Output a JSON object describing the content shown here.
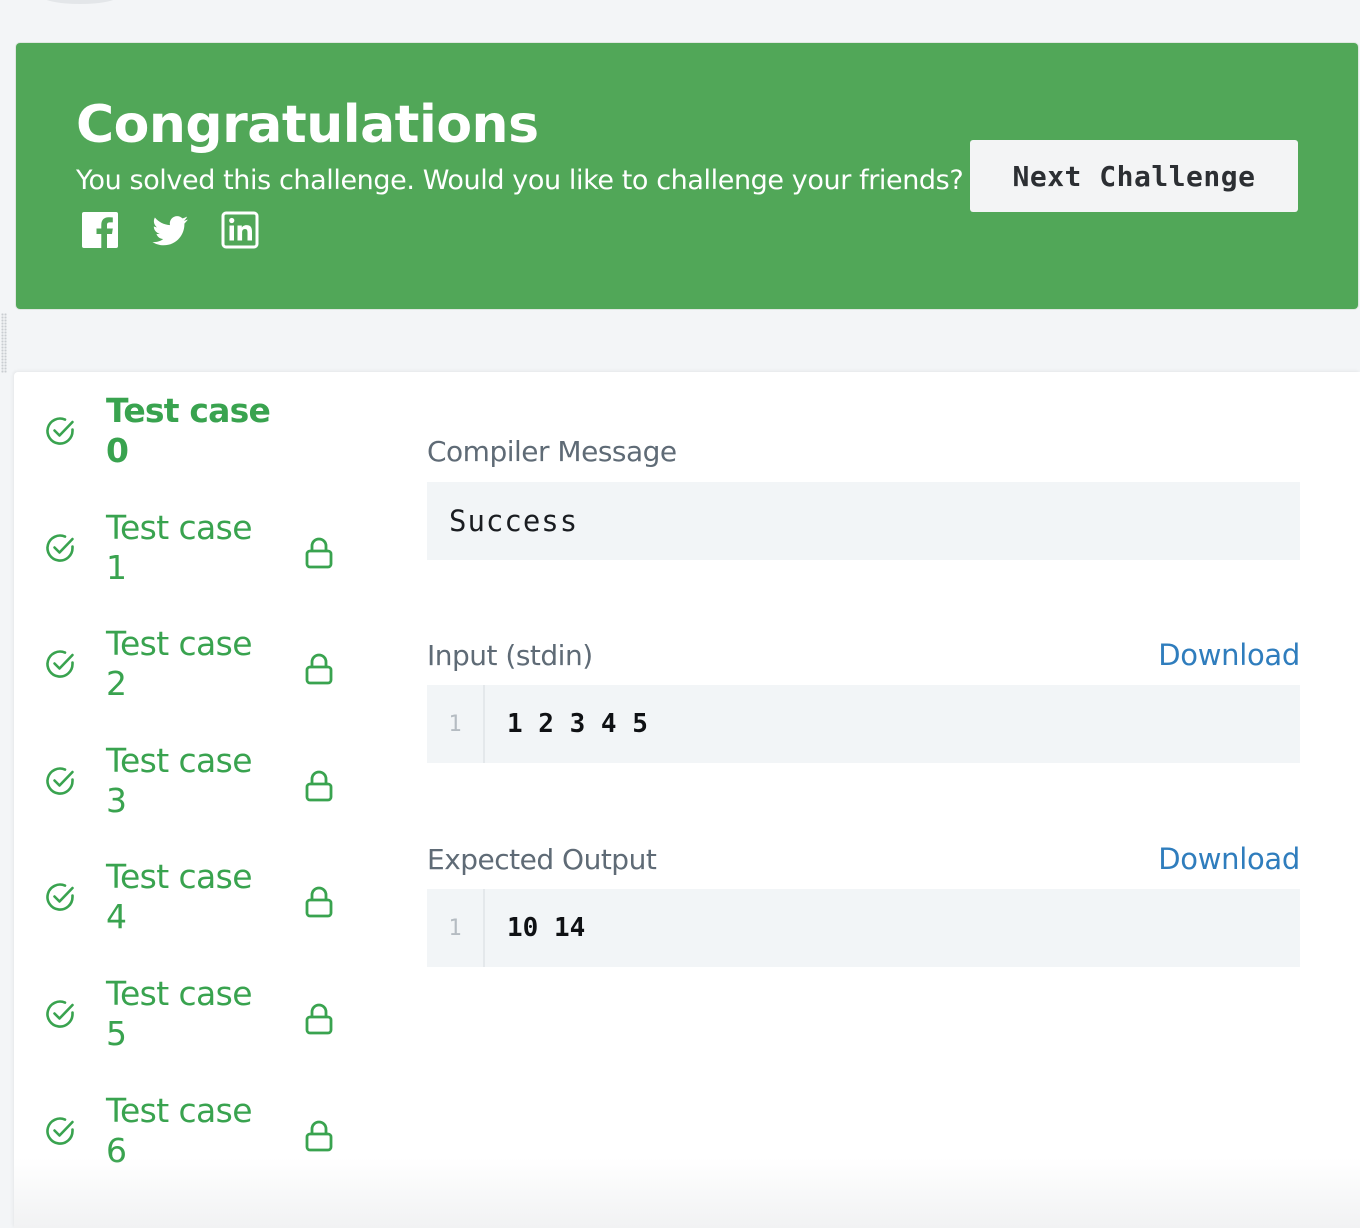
{
  "banner": {
    "title": "Congratulations",
    "subtitle": "You solved this challenge. Would you like to challenge your friends?",
    "next_label": "Next Challenge",
    "socials": [
      "facebook-icon",
      "twitter-icon",
      "linkedin-icon"
    ],
    "color": "#51a758"
  },
  "test_cases": [
    {
      "label": "Test case 0",
      "passed": true,
      "locked": false,
      "active": true
    },
    {
      "label": "Test case 1",
      "passed": true,
      "locked": true,
      "active": false
    },
    {
      "label": "Test case 2",
      "passed": true,
      "locked": true,
      "active": false
    },
    {
      "label": "Test case 3",
      "passed": true,
      "locked": true,
      "active": false
    },
    {
      "label": "Test case 4",
      "passed": true,
      "locked": true,
      "active": false
    },
    {
      "label": "Test case 5",
      "passed": true,
      "locked": true,
      "active": false
    },
    {
      "label": "Test case 6",
      "passed": true,
      "locked": true,
      "active": false
    }
  ],
  "detail": {
    "compiler": {
      "title": "Compiler Message",
      "message": "Success"
    },
    "input": {
      "title": "Input (stdin)",
      "download": "Download",
      "line_no": "1",
      "content": "1 2 3 4 5"
    },
    "expected": {
      "title": "Expected Output",
      "download": "Download",
      "line_no": "1",
      "content": "10 14"
    }
  },
  "colors": {
    "success": "#39a34f",
    "link": "#2f7dbd"
  }
}
